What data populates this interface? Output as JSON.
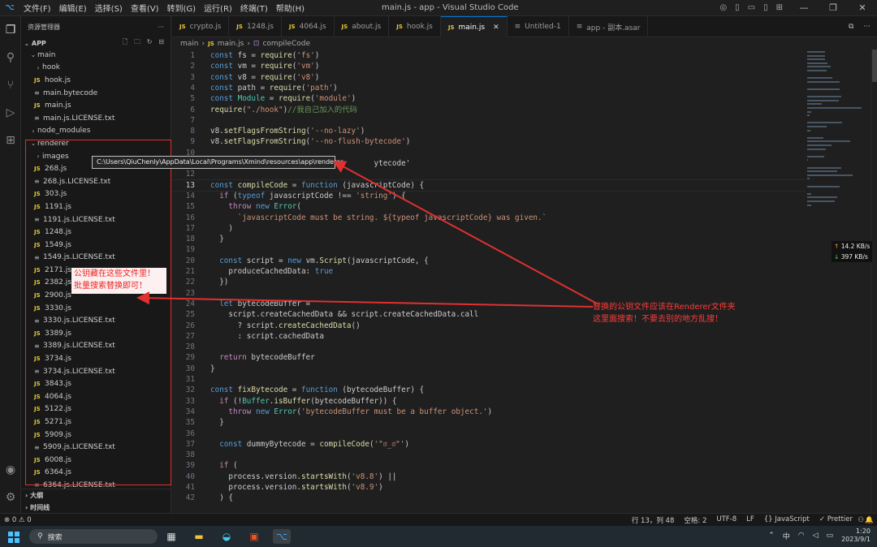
{
  "titlebar": {
    "menu": [
      "文件(F)",
      "编辑(E)",
      "选择(S)",
      "查看(V)",
      "转到(G)",
      "运行(R)",
      "终端(T)",
      "帮助(H)"
    ],
    "title": "main.js - app - Visual Studio Code"
  },
  "sidebar": {
    "header": "资源管理器",
    "section": "APP",
    "tree": [
      {
        "label": "main",
        "depth": 1,
        "type": "folder-open"
      },
      {
        "label": "hook",
        "depth": 2,
        "type": "folder"
      },
      {
        "label": "hook.js",
        "depth": 2,
        "type": "js"
      },
      {
        "label": "main.bytecode",
        "depth": 2,
        "type": "file"
      },
      {
        "label": "main.js",
        "depth": 2,
        "type": "js"
      },
      {
        "label": "main.js.LICENSE.txt",
        "depth": 2,
        "type": "txt"
      },
      {
        "label": "node_modules",
        "depth": 1,
        "type": "folder"
      },
      {
        "label": "renderer",
        "depth": 1,
        "type": "folder-open"
      },
      {
        "label": "images",
        "depth": 2,
        "type": "folder"
      },
      {
        "label": "268.js",
        "depth": 2,
        "type": "js"
      },
      {
        "label": "268.js.LICENSE.txt",
        "depth": 2,
        "type": "txt"
      },
      {
        "label": "303.js",
        "depth": 2,
        "type": "js"
      },
      {
        "label": "1191.js",
        "depth": 2,
        "type": "js"
      },
      {
        "label": "1191.js.LICENSE.txt",
        "depth": 2,
        "type": "txt"
      },
      {
        "label": "1248.js",
        "depth": 2,
        "type": "js"
      },
      {
        "label": "1549.js",
        "depth": 2,
        "type": "js"
      },
      {
        "label": "1549.js.LICENSE.txt",
        "depth": 2,
        "type": "txt"
      },
      {
        "label": "2171.js",
        "depth": 2,
        "type": "js"
      },
      {
        "label": "2382.js",
        "depth": 2,
        "type": "js"
      },
      {
        "label": "2900.js",
        "depth": 2,
        "type": "js"
      },
      {
        "label": "3330.js",
        "depth": 2,
        "type": "js"
      },
      {
        "label": "3330.js.LICENSE.txt",
        "depth": 2,
        "type": "txt"
      },
      {
        "label": "3389.js",
        "depth": 2,
        "type": "js"
      },
      {
        "label": "3389.js.LICENSE.txt",
        "depth": 2,
        "type": "txt"
      },
      {
        "label": "3734.js",
        "depth": 2,
        "type": "js"
      },
      {
        "label": "3734.js.LICENSE.txt",
        "depth": 2,
        "type": "txt"
      },
      {
        "label": "3843.js",
        "depth": 2,
        "type": "js"
      },
      {
        "label": "4064.js",
        "depth": 2,
        "type": "js"
      },
      {
        "label": "5122.js",
        "depth": 2,
        "type": "js"
      },
      {
        "label": "5271.js",
        "depth": 2,
        "type": "js"
      },
      {
        "label": "5909.js",
        "depth": 2,
        "type": "js"
      },
      {
        "label": "5909.js.LICENSE.txt",
        "depth": 2,
        "type": "txt"
      },
      {
        "label": "6008.js",
        "depth": 2,
        "type": "js"
      },
      {
        "label": "6364.js",
        "depth": 2,
        "type": "js"
      },
      {
        "label": "6364.js.LICENSE.txt",
        "depth": 2,
        "type": "txt"
      }
    ],
    "outline": "大纲",
    "timeline": "时间线"
  },
  "tabs": [
    {
      "label": "crypto.js",
      "icon": "JS",
      "active": false
    },
    {
      "label": "1248.js",
      "icon": "JS",
      "active": false
    },
    {
      "label": "4064.js",
      "icon": "JS",
      "active": false
    },
    {
      "label": "about.js",
      "icon": "JS",
      "active": false
    },
    {
      "label": "hook.js",
      "icon": "JS",
      "active": false
    },
    {
      "label": "main.js",
      "icon": "JS",
      "active": true
    },
    {
      "label": "Untitled-1",
      "icon": "≡",
      "active": false
    },
    {
      "label": "app - 副本.asar",
      "icon": "≡",
      "active": false
    }
  ],
  "breadcrumb": {
    "folder": "main",
    "file": "main.js",
    "symbol": "compileCode"
  },
  "code": [
    "const fs = require('fs')",
    "const vm = require('vm')",
    "const v8 = require('v8')",
    "const path = require('path')",
    "const Module = require('module')",
    "require(\"./hook\")//我自己加入的代码",
    "",
    "v8.setFlagsFromString('--no-lazy')",
    "v8.setFlagsFromString('--no-flush-bytecode')",
    "",
    "                                    ytecode'",
    "",
    "const compileCode = function (javascriptCode) {",
    "  if (typeof javascriptCode !== 'string') {",
    "    throw new Error(",
    "      `javascriptCode must be string. ${typeof javascriptCode} was given.`",
    "    )",
    "  }",
    "",
    "  const script = new vm.Script(javascriptCode, {",
    "    produceCachedData: true",
    "  })",
    "",
    "  let bytecodeBuffer =",
    "    script.createCachedData && script.createCachedData.call",
    "      ? script.createCachedData()",
    "      : script.cachedData",
    "",
    "  return bytecodeBuffer",
    "}",
    "",
    "const fixBytecode = function (bytecodeBuffer) {",
    "  if (!Buffer.isBuffer(bytecodeBuffer)) {",
    "    throw new Error('bytecodeBuffer must be a buffer object.')",
    "  }",
    "",
    "  const dummyBytecode = compileCode('\"ಠ_ಠ\"')",
    "",
    "  if (",
    "    process.version.startsWith('v8.8') ||",
    "    process.version.startsWith('v8.9')",
    "  ) {"
  ],
  "current_line": 13,
  "tooltip": "C:\\Users\\QiuChenly\\AppData\\Local\\Programs\\Xmind\\resources\\app\\renderer",
  "annotations": {
    "left_note": [
      "公钥藏在这些文件里！",
      "批量搜索替换即可！"
    ],
    "right_note": [
      "替换的公钥文件应该在Renderer文件夹",
      "这里面搜索！不要去别的地方乱搜！"
    ]
  },
  "net_speed": {
    "up": "14.2 KB/s",
    "down": "397 KB/s"
  },
  "status": {
    "problems": "⊗ 0  ⚠ 0",
    "position": "行 13，列 48",
    "spaces": "空格: 2",
    "encoding": "UTF-8",
    "eol": "LF",
    "language": "{} JavaScript",
    "formatter": "✓ Prettier"
  },
  "taskbar": {
    "search": "搜索",
    "ime": "中",
    "time": "1:20",
    "date": "2023/9/1"
  },
  "colors": {
    "accent": "#0078d4",
    "annotation": "#e03030",
    "js_icon": "#e6c73a"
  }
}
